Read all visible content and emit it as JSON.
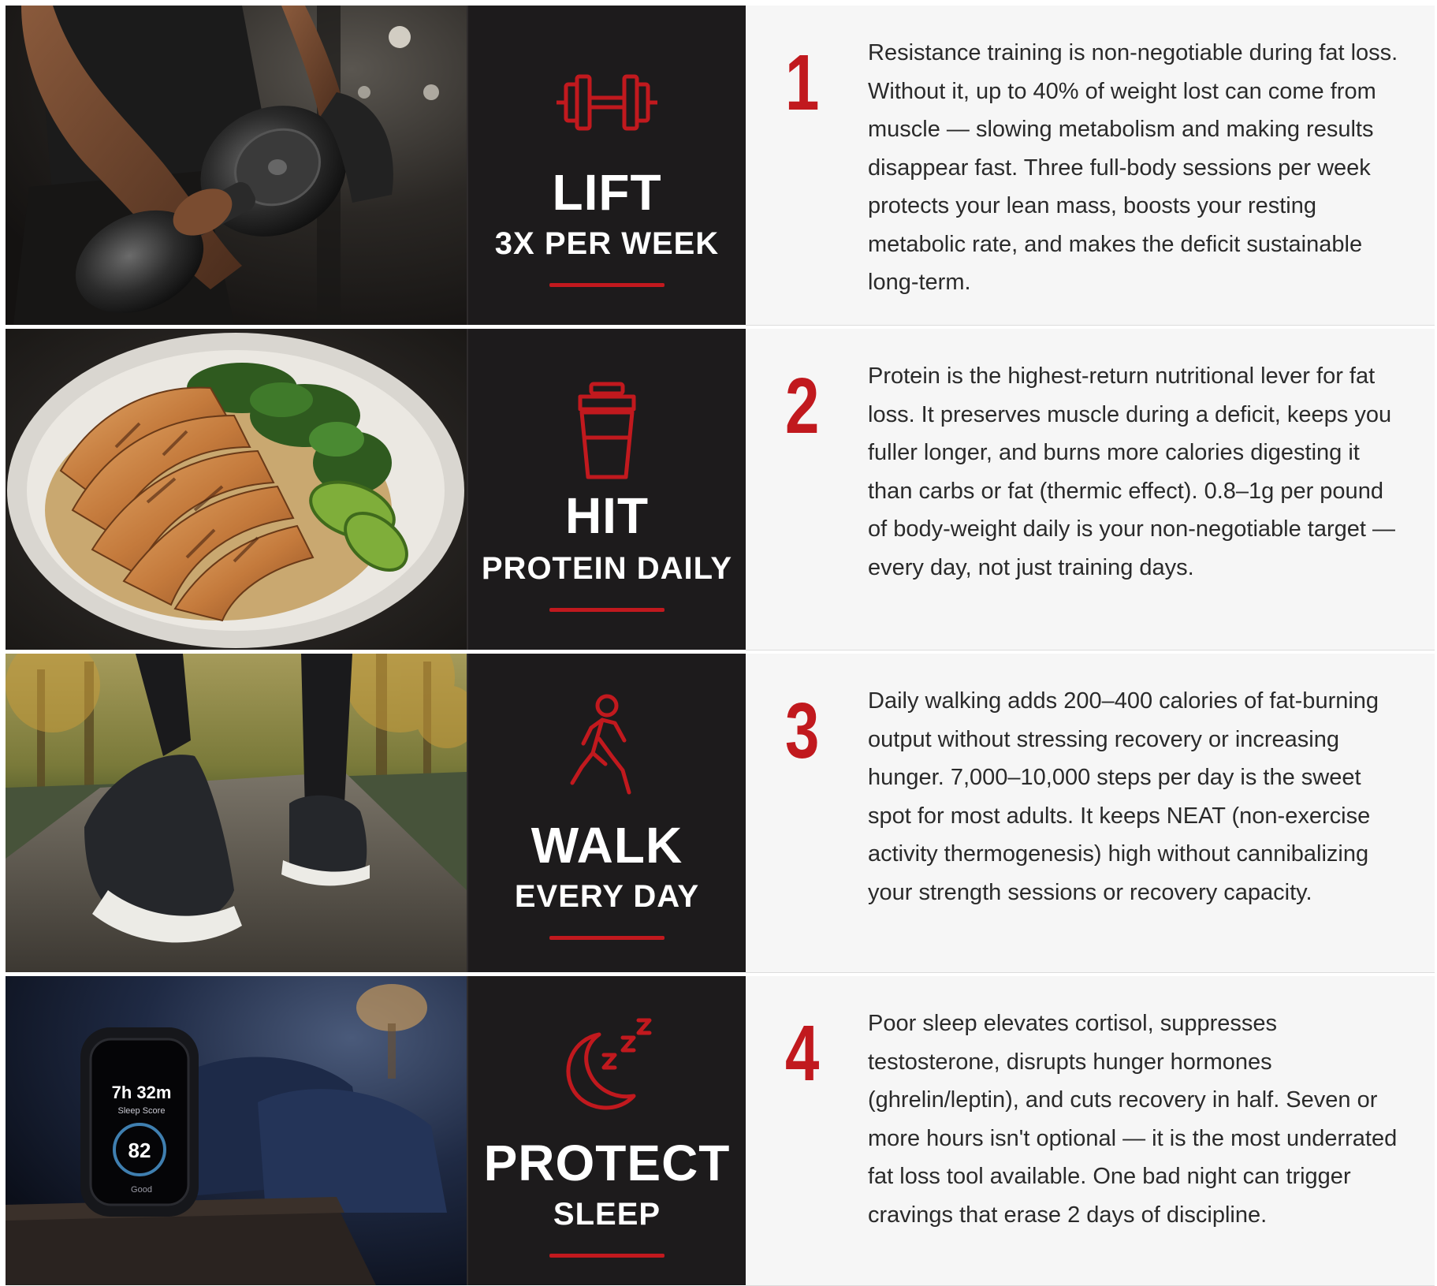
{
  "accent_color": "#c1191e",
  "panel_color": "#1d1b1c",
  "steps": [
    {
      "number": "1",
      "title": "LIFT",
      "subtitle": "3X PER WEEK",
      "icon": "dumbbell-icon",
      "photo": "dumbbell-row-photo",
      "text": "Resistance training is non-negotiable during fat loss. Without it, up to 40% of weight lost can come from muscle — slowing metabolism and making results disappear fast. Three full-body sessions per week protects your lean mass, boosts your resting metabolic rate, and makes the deficit sustainable long-term."
    },
    {
      "number": "2",
      "title": "HIT",
      "subtitle": "PROTEIN DAILY",
      "icon": "protein-shaker-icon",
      "photo": "chicken-plate-photo",
      "text": "Protein is the highest-return nutritional lever for fat loss. It preserves muscle during a deficit, keeps you fuller longer, and burns more calories digesting it than carbs or fat (thermic effect). 0.8–1g per pound of body-weight daily is your non-negotiable target — every day, not just training days."
    },
    {
      "number": "3",
      "title": "WALK",
      "subtitle": "EVERY DAY",
      "icon": "walking-person-icon",
      "photo": "walking-shoes-photo",
      "text": "Daily walking adds 200–400 calories of fat-burning output without stressing recovery or increasing hunger. 7,000–10,000 steps per day is the sweet spot for most adults. It keeps NEAT (non-exercise activity thermogenesis) high without cannibalizing your strength sessions or recovery capacity."
    },
    {
      "number": "4",
      "title": "PROTECT",
      "subtitle": "SLEEP",
      "icon": "moon-sleep-icon",
      "photo": "smartwatch-bedroom-photo",
      "text": "Poor sleep elevates cortisol, suppresses testosterone, disrupts hunger hormones (ghrelin/leptin), and cuts recovery in half. Seven or more hours isn't optional — it is the most underrated fat loss tool available. One bad night can trigger cravings that erase 2 days of discipline."
    }
  ],
  "watch": {
    "time": "7h 32m",
    "subtitle": "Sleep Score",
    "score": "82",
    "rating": "Good"
  }
}
